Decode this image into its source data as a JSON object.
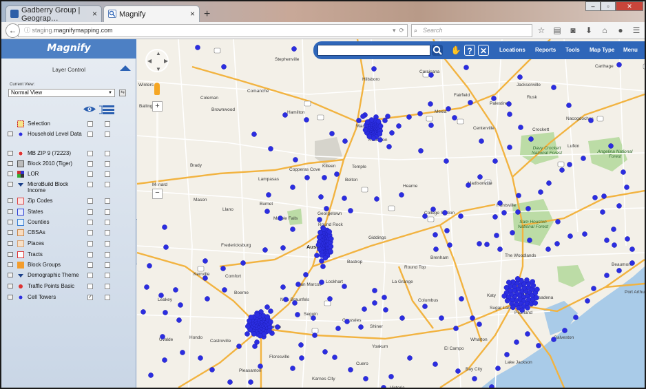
{
  "browser": {
    "tabs": [
      {
        "label": "Gadberry Group | Geograp…",
        "active": false
      },
      {
        "label": "Magnify",
        "active": true
      }
    ],
    "new_tab": "+",
    "url_host": "staging.",
    "url_rest": "magnifymapping.com",
    "search_placeholder": "Search"
  },
  "app": {
    "brand": "Magnify",
    "panel_title": "Layer Control",
    "current_view_label": "Current View:",
    "current_view_value": "Normal View",
    "layers": [
      {
        "label": "Selection",
        "icon": "selection-icon",
        "checked": false
      },
      {
        "label": "Household Level Data",
        "icon": "household-icon",
        "checked": false
      },
      {
        "label": "MB ZIP 9 (72223)",
        "icon": "zip9-icon",
        "checked": false
      },
      {
        "label": "Block 2010 (Tiger)",
        "icon": "block-icon",
        "checked": false
      },
      {
        "label": "LOR",
        "icon": "lor-icon",
        "checked": false
      },
      {
        "label": "MicroBuild Block Income",
        "icon": "microbuild-icon",
        "checked": false
      },
      {
        "label": "Zip Codes",
        "icon": "zipcodes-icon",
        "checked": false
      },
      {
        "label": "States",
        "icon": "states-icon",
        "checked": false
      },
      {
        "label": "Counties",
        "icon": "counties-icon",
        "checked": false
      },
      {
        "label": "CBSAs",
        "icon": "cbsas-icon",
        "checked": false
      },
      {
        "label": "Places",
        "icon": "places-icon",
        "checked": false
      },
      {
        "label": "Tracts",
        "icon": "tracts-icon",
        "checked": false
      },
      {
        "label": "Block Groups",
        "icon": "blockgroups-icon",
        "checked": false
      },
      {
        "label": "Demographic Theme",
        "icon": "demographic-icon",
        "checked": false
      },
      {
        "label": "Traffic Points Basic",
        "icon": "traffic-icon",
        "checked": false
      },
      {
        "label": "Cell Towers",
        "icon": "celltower-icon",
        "checked": true
      }
    ],
    "checkmark": "✓"
  },
  "map_toolbar": {
    "menus": [
      "Locations",
      "Reports",
      "Tools",
      "Map Type",
      "Menu"
    ],
    "help_label": "?",
    "close_label": "✕"
  },
  "map_controls": {
    "zoom_in": "+",
    "zoom_out": "−"
  },
  "colors": {
    "toolbar_blue": "#2f66b9",
    "tower_dot": "#2b2de0",
    "highway_orange": "#f2b340",
    "park_green": "#bcdca6",
    "water_blue": "#a9cbe8"
  },
  "map_labels": {
    "cities": [
      {
        "name": "Stephenville",
        "big": false
      },
      {
        "name": "Corsicana",
        "big": false
      },
      {
        "name": "Hillsboro",
        "big": false
      },
      {
        "name": "Comanche",
        "big": false
      },
      {
        "name": "Coleman",
        "big": false
      },
      {
        "name": "Brownwood",
        "big": false
      },
      {
        "name": "Hamilton",
        "big": false
      },
      {
        "name": "Waco",
        "big": false
      },
      {
        "name": "Robinson",
        "big": false
      },
      {
        "name": "Killeen",
        "big": false
      },
      {
        "name": "Temple",
        "big": false
      },
      {
        "name": "Belton",
        "big": false
      },
      {
        "name": "Copperas Cove",
        "big": false
      },
      {
        "name": "Lampasas",
        "big": false
      },
      {
        "name": "Brady",
        "big": false
      },
      {
        "name": "Menard",
        "big": false
      },
      {
        "name": "Mason",
        "big": false
      },
      {
        "name": "Llano",
        "big": false
      },
      {
        "name": "Burnet",
        "big": false
      },
      {
        "name": "Marble Falls",
        "big": false
      },
      {
        "name": "Georgetown",
        "big": false
      },
      {
        "name": "Round Rock",
        "big": false
      },
      {
        "name": "Austin",
        "big": true
      },
      {
        "name": "Fredericksburg",
        "big": false
      },
      {
        "name": "Kerrville",
        "big": false
      },
      {
        "name": "Comfort",
        "big": false
      },
      {
        "name": "Boerne",
        "big": false
      },
      {
        "name": "San Marcos",
        "big": false
      },
      {
        "name": "New Braunfels",
        "big": false
      },
      {
        "name": "San Antonio",
        "big": true
      },
      {
        "name": "Seguin",
        "big": false
      },
      {
        "name": "Gonzales",
        "big": false
      },
      {
        "name": "Lockhart",
        "big": false
      },
      {
        "name": "Bastrop",
        "big": false
      },
      {
        "name": "Giddings",
        "big": false
      },
      {
        "name": "La Grange",
        "big": false
      },
      {
        "name": "Columbus",
        "big": false
      },
      {
        "name": "Round Top",
        "big": false
      },
      {
        "name": "Brenham",
        "big": false
      },
      {
        "name": "College Station",
        "big": false
      },
      {
        "name": "Hearne",
        "big": false
      },
      {
        "name": "Madisonville",
        "big": false
      },
      {
        "name": "Huntsville",
        "big": false
      },
      {
        "name": "The Woodlands",
        "big": false
      },
      {
        "name": "Houston",
        "big": true
      },
      {
        "name": "Katy",
        "big": false
      },
      {
        "name": "Sugar Land",
        "big": false
      },
      {
        "name": "Pasadena",
        "big": false
      },
      {
        "name": "Pearland",
        "big": false
      },
      {
        "name": "Galveston",
        "big": false
      },
      {
        "name": "Bay City",
        "big": false
      },
      {
        "name": "El Campo",
        "big": false
      },
      {
        "name": "Wharton",
        "big": false
      },
      {
        "name": "Lake Jackson",
        "big": false
      },
      {
        "name": "Victoria",
        "big": false
      },
      {
        "name": "Cuero",
        "big": false
      },
      {
        "name": "Floresville",
        "big": false
      },
      {
        "name": "Pleasanton",
        "big": false
      },
      {
        "name": "Karnes City",
        "big": false
      },
      {
        "name": "Shiner",
        "big": false
      },
      {
        "name": "Yoakum",
        "big": false
      },
      {
        "name": "Hondo",
        "big": false
      },
      {
        "name": "Castroville",
        "big": false
      },
      {
        "name": "Uvalde",
        "big": false
      },
      {
        "name": "Leakey",
        "big": false
      },
      {
        "name": "Palestine",
        "big": false
      },
      {
        "name": "Jacksonville",
        "big": false
      },
      {
        "name": "Rusk",
        "big": false
      },
      {
        "name": "Nacogdoches",
        "big": false
      },
      {
        "name": "Lufkin",
        "big": false
      },
      {
        "name": "Crockett",
        "big": false
      },
      {
        "name": "Carthage",
        "big": false
      },
      {
        "name": "Beaumont",
        "big": false
      },
      {
        "name": "Port Arthur",
        "big": false
      },
      {
        "name": "Winters",
        "big": false
      },
      {
        "name": "Ballinger",
        "big": false
      },
      {
        "name": "Fairfield",
        "big": false
      },
      {
        "name": "Mexia",
        "big": false
      },
      {
        "name": "Centerville",
        "big": false
      }
    ],
    "parks": [
      "Davy Crockett National Forest",
      "Angelina National Forest",
      "Sam Houston National Forest"
    ]
  }
}
